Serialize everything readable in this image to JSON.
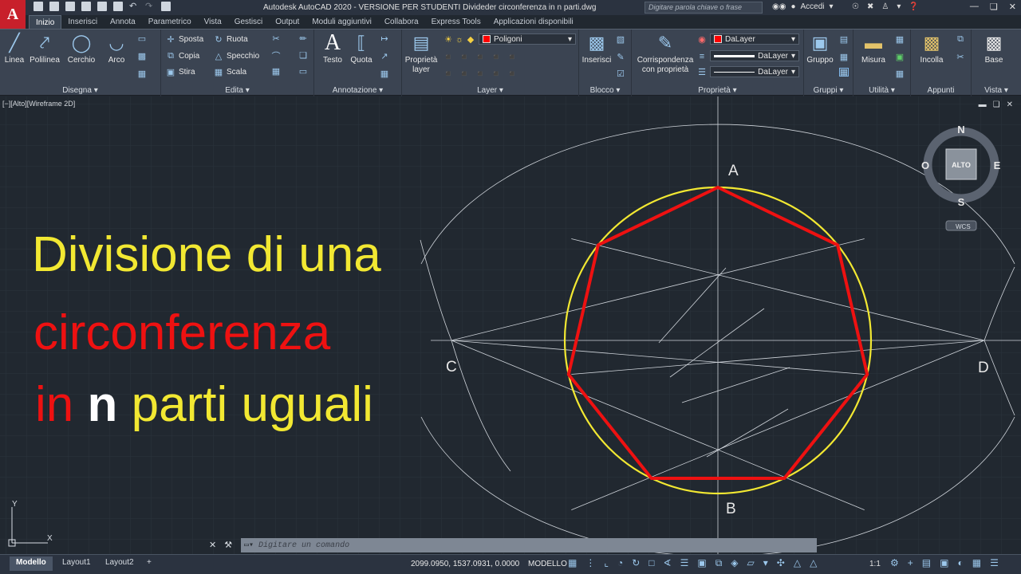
{
  "app": {
    "logo_letter": "A",
    "title": "Autodesk AutoCAD 2020 - VERSIONE PER STUDENTI    Divideder circonferenza in n parti.dwg",
    "search_placeholder": "Digitare parola chiave o frase",
    "user_label": "Accedi"
  },
  "tabs": [
    "Inizio",
    "Inserisci",
    "Annota",
    "Parametrico",
    "Vista",
    "Gestisci",
    "Output",
    "Moduli aggiuntivi",
    "Collabora",
    "Express Tools",
    "Applicazioni disponibili"
  ],
  "ribbon": {
    "disegna": {
      "label": "Disegna",
      "linea": "Linea",
      "polilinea": "Polilinea",
      "cerchio": "Cerchio",
      "arco": "Arco"
    },
    "edita": {
      "label": "Edita",
      "sposta": "Sposta",
      "ruota": "Ruota",
      "copia": "Copia",
      "specchio": "Specchio",
      "stira": "Stira",
      "scala": "Scala"
    },
    "annotazione": {
      "label": "Annotazione",
      "testo": "Testo",
      "quota": "Quota"
    },
    "layer": {
      "label": "Layer",
      "proprieta_layer": "Proprietà\nlayer",
      "current_layer": "Poligoni"
    },
    "blocco": {
      "label": "Blocco",
      "inserisci": "Inserisci"
    },
    "proprieta": {
      "label": "Proprietà",
      "corrispondenza": "Corrispondenza\ncon proprietà",
      "color": "DaLayer",
      "lineweight": "DaLayer",
      "linetype": "DaLayer"
    },
    "gruppi": {
      "label": "Gruppi",
      "gruppo": "Gruppo"
    },
    "utilita": {
      "label": "Utilità",
      "misura": "Misura"
    },
    "appunti": {
      "label": "Appunti",
      "incolla": "Incolla"
    },
    "vista": {
      "label": "Vista",
      "base": "Base"
    }
  },
  "viewport": {
    "label": "[−][Alto][Wireframe 2D]",
    "viewcube": {
      "north": "N",
      "south": "S",
      "east": "E",
      "west": "O",
      "face": "ALTO",
      "ucs": "WCS"
    },
    "points": {
      "a": "A",
      "b": "B",
      "c": "C",
      "d": "D"
    },
    "ucs_x": "X",
    "ucs_y": "Y"
  },
  "headline": {
    "line1": "Divisione di una",
    "line2": "circonferenza",
    "line3_a": "in",
    "line3_b": "n",
    "line3_c": "parti uguali",
    "colors": {
      "yellow": "#f2e832",
      "red": "#ee1111",
      "white": "#ffffff"
    }
  },
  "command": {
    "placeholder": "Digitare un comando"
  },
  "status": {
    "layouts": [
      "Modello",
      "Layout1",
      "Layout2"
    ],
    "coordinates": "2099.0950, 1537.0931, 0.0000",
    "mode": "MODELLO",
    "scale": "1:1"
  }
}
